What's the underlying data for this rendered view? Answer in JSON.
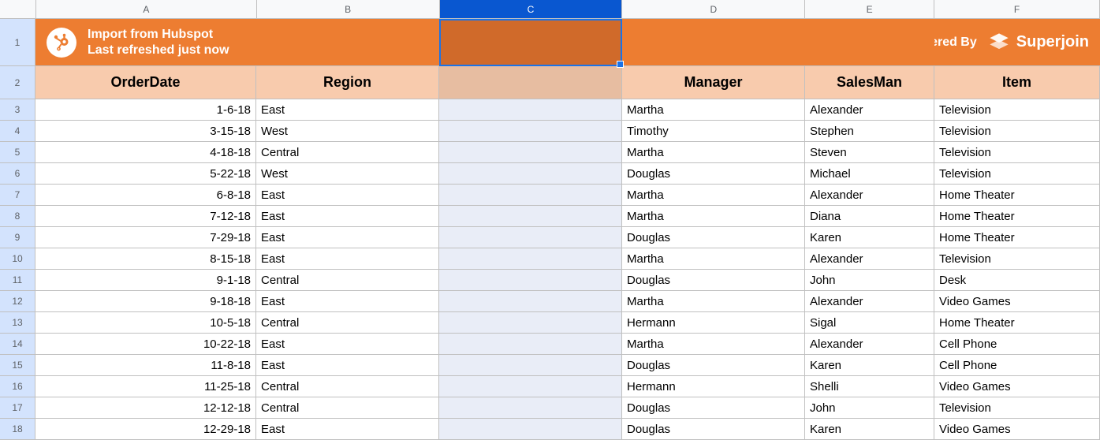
{
  "columns": [
    "A",
    "B",
    "C",
    "D",
    "E",
    "F"
  ],
  "selectedColumn": "C",
  "banner": {
    "title": "Import from Hubspot",
    "subtitle": "Last refreshed just now",
    "powered_by": "Powered By",
    "brand": "Superjoin"
  },
  "headers": {
    "A": "OrderDate",
    "B": "Region",
    "C": "",
    "D": "Manager",
    "E": "SalesMan",
    "F": "Item"
  },
  "rows": [
    {
      "n": 3,
      "A": "1-6-18",
      "B": "East",
      "C": "",
      "D": "Martha",
      "E": "Alexander",
      "F": "Television"
    },
    {
      "n": 4,
      "A": "3-15-18",
      "B": "West",
      "C": "",
      "D": "Timothy",
      "E": "Stephen",
      "F": "Television"
    },
    {
      "n": 5,
      "A": "4-18-18",
      "B": "Central",
      "C": "",
      "D": "Martha",
      "E": "Steven",
      "F": "Television"
    },
    {
      "n": 6,
      "A": "5-22-18",
      "B": "West",
      "C": "",
      "D": "Douglas",
      "E": "Michael",
      "F": "Television"
    },
    {
      "n": 7,
      "A": "6-8-18",
      "B": "East",
      "C": "",
      "D": "Martha",
      "E": "Alexander",
      "F": "Home Theater"
    },
    {
      "n": 8,
      "A": "7-12-18",
      "B": "East",
      "C": "",
      "D": "Martha",
      "E": "Diana",
      "F": "Home Theater"
    },
    {
      "n": 9,
      "A": "7-29-18",
      "B": "East",
      "C": "",
      "D": "Douglas",
      "E": "Karen",
      "F": "Home Theater"
    },
    {
      "n": 10,
      "A": "8-15-18",
      "B": "East",
      "C": "",
      "D": "Martha",
      "E": "Alexander",
      "F": "Television"
    },
    {
      "n": 11,
      "A": "9-1-18",
      "B": "Central",
      "C": "",
      "D": "Douglas",
      "E": "John",
      "F": "Desk"
    },
    {
      "n": 12,
      "A": "9-18-18",
      "B": "East",
      "C": "",
      "D": "Martha",
      "E": "Alexander",
      "F": "Video Games"
    },
    {
      "n": 13,
      "A": "10-5-18",
      "B": "Central",
      "C": "",
      "D": "Hermann",
      "E": "Sigal",
      "F": "Home Theater"
    },
    {
      "n": 14,
      "A": "10-22-18",
      "B": "East",
      "C": "",
      "D": "Martha",
      "E": "Alexander",
      "F": "Cell Phone"
    },
    {
      "n": 15,
      "A": "11-8-18",
      "B": "East",
      "C": "",
      "D": "Douglas",
      "E": "Karen",
      "F": "Cell Phone"
    },
    {
      "n": 16,
      "A": "11-25-18",
      "B": "Central",
      "C": "",
      "D": "Hermann",
      "E": "Shelli",
      "F": "Video Games"
    },
    {
      "n": 17,
      "A": "12-12-18",
      "B": "Central",
      "C": "",
      "D": "Douglas",
      "E": "John",
      "F": "Television"
    },
    {
      "n": 18,
      "A": "12-29-18",
      "B": "East",
      "C": "",
      "D": "Douglas",
      "E": "Karen",
      "F": "Video Games"
    }
  ]
}
